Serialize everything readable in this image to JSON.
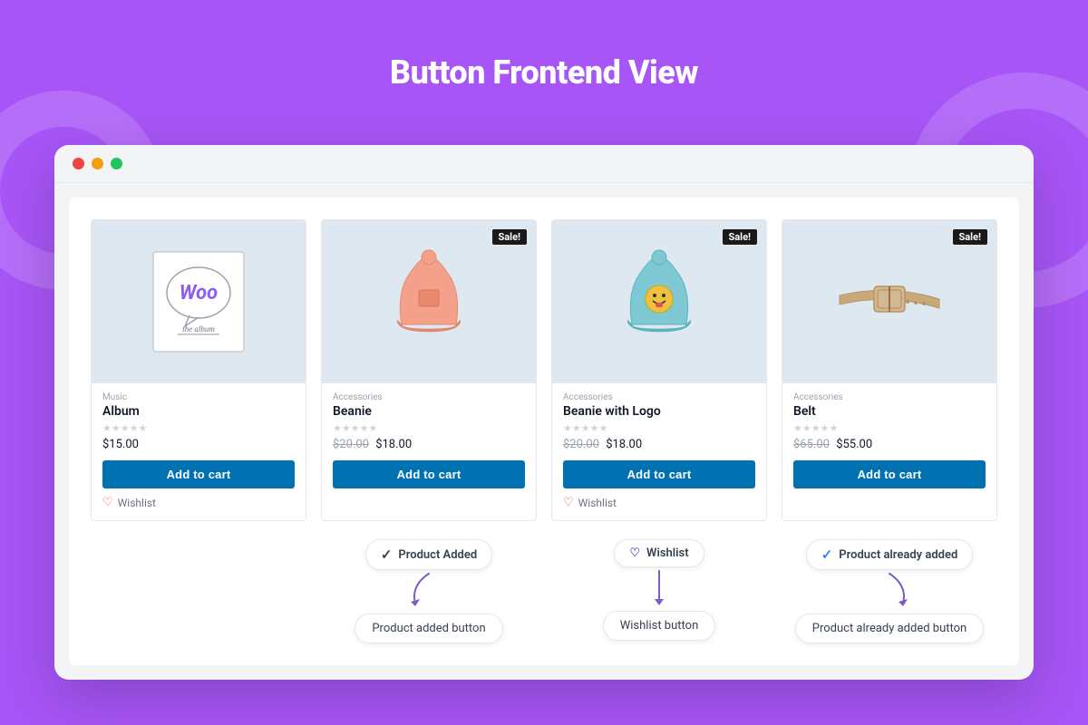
{
  "header": {
    "title": "Button Frontend View"
  },
  "products": [
    {
      "id": "album",
      "category": "Music",
      "name": "Album",
      "stars": 0,
      "price": "$15.00",
      "sale": false,
      "hasWishlist": true,
      "buttonLabel": "Add to cart"
    },
    {
      "id": "beanie",
      "category": "Accessories",
      "name": "Beanie",
      "stars": 0,
      "originalPrice": "$20.00",
      "price": "$18.00",
      "sale": true,
      "hasWishlist": false,
      "buttonLabel": "Add to cart",
      "statusPill": "Product Added",
      "statusPillType": "check"
    },
    {
      "id": "beanie-logo",
      "category": "Accessories",
      "name": "Beanie with Logo",
      "stars": 0,
      "originalPrice": "$20.00",
      "price": "$18.00",
      "sale": true,
      "hasWishlist": true,
      "wishlistPill": true,
      "buttonLabel": "Add to cart"
    },
    {
      "id": "belt",
      "category": "Accessories",
      "name": "Belt",
      "stars": 0,
      "originalPrice": "$65.00",
      "price": "$55.00",
      "sale": true,
      "hasWishlist": false,
      "buttonLabel": "Add to cart",
      "statusPill": "Product already added",
      "statusPillType": "check-blue"
    }
  ],
  "labels": {
    "product_added_button": "Product added button",
    "wishlist_button": "Wishlist button",
    "product_already_added_button": "Product already added button"
  },
  "browser_dots": {
    "red": "●",
    "yellow": "●",
    "green": "●"
  }
}
